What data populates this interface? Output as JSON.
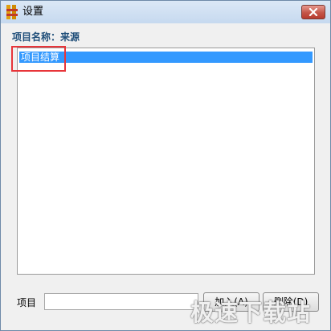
{
  "window": {
    "title": "设置",
    "close_icon": "close-icon",
    "app_icon": "app-icon"
  },
  "project_name_label": "项目名称：来源",
  "list": {
    "items": [
      {
        "label": "项目结算",
        "selected": true
      }
    ]
  },
  "footer": {
    "item_label": "项目",
    "item_value": "",
    "add_button": "加入(A)",
    "delete_button": "删除(D)"
  },
  "watermark": "极速下载站",
  "colors": {
    "selection": "#3399ff",
    "highlight_frame": "#e8353a",
    "heading": "#1f4e79",
    "close_button": "#c45548"
  }
}
